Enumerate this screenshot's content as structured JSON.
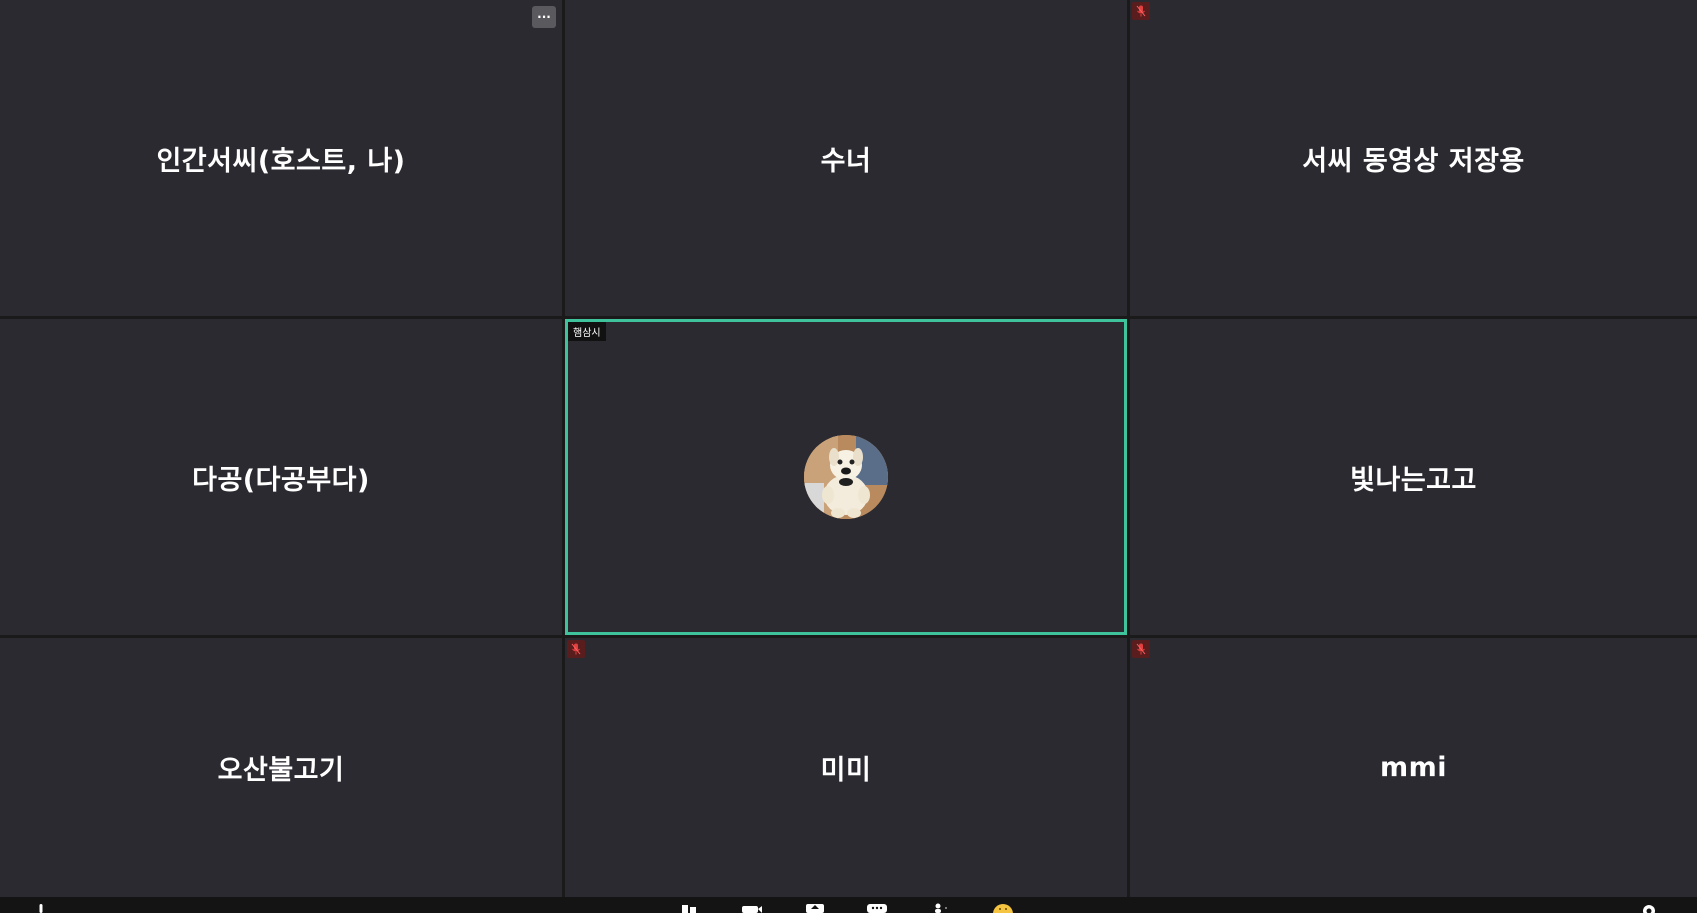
{
  "meeting": {
    "tiles": [
      {
        "name": "인간서씨(호스트, 나)"
      },
      {
        "name": "수너"
      },
      {
        "name": "서씨 동영상 저장용"
      },
      {
        "name": "다공(다공부다)"
      },
      {
        "label": "햄삼시"
      },
      {
        "name": "빛나는고고"
      },
      {
        "name": "오산불고기"
      },
      {
        "name": "미미"
      },
      {
        "name": "mmi"
      }
    ],
    "more_button_label": "···"
  },
  "colors": {
    "tile_bg": "#2a2a30",
    "active_speaker_border": "#3fc39c",
    "mute_badge": "#5a1d1d"
  },
  "icons": {
    "toolbar": [
      "mic-icon",
      "gallery-view-icon",
      "video-icon",
      "share-screen-icon",
      "chat-icon",
      "participants-icon",
      "reactions-icon",
      "settings-icon"
    ],
    "tile_badges": [
      "more-options-icon",
      "muted-mic-icon"
    ]
  }
}
